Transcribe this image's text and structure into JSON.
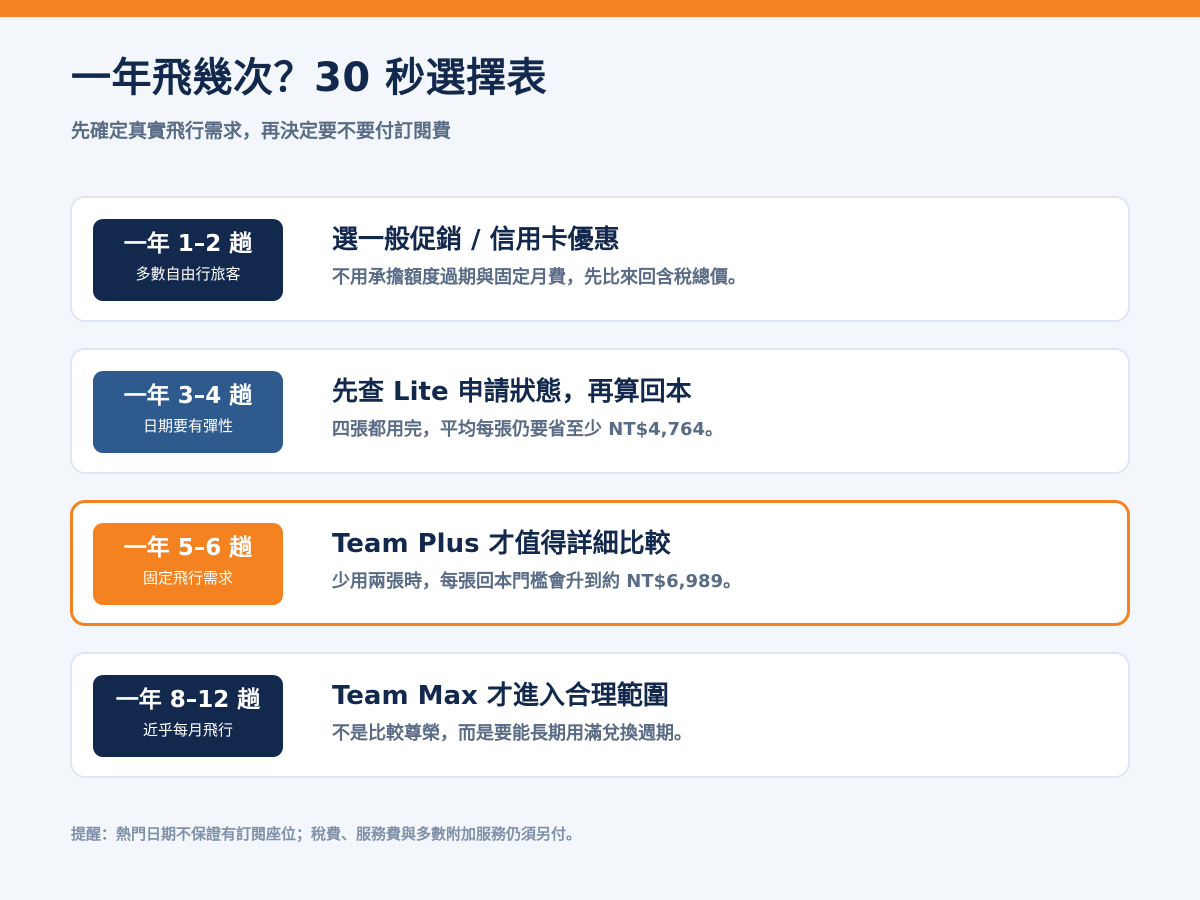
{
  "header": {
    "title": "一年飛幾次？30 秒選擇表",
    "subtitle": "先確定真實飛行需求，再決定要不要付訂閱費"
  },
  "colors": {
    "accent": "#f58220",
    "navy": "#13284d",
    "steel_blue": "#2f5a8e",
    "muted_text": "#5a6b86"
  },
  "cards": [
    {
      "badge_title": "一年 1–2 趟",
      "badge_sub": "多數自由行旅客",
      "heading": "選一般促銷 / 信用卡優惠",
      "desc": "不用承擔額度過期與固定月費，先比來回含稅總價。",
      "badge_color": "#13284d",
      "highlighted": false
    },
    {
      "badge_title": "一年 3–4 趟",
      "badge_sub": "日期要有彈性",
      "heading": "先查 Lite 申請狀態，再算回本",
      "desc": "四張都用完，平均每張仍要省至少 NT$4,764。",
      "badge_color": "#2f5a8e",
      "highlighted": false
    },
    {
      "badge_title": "一年 5–6 趟",
      "badge_sub": "固定飛行需求",
      "heading": "Team Plus 才值得詳細比較",
      "desc": "少用兩張時，每張回本門檻會升到約 NT$6,989。",
      "badge_color": "#f58220",
      "highlighted": true
    },
    {
      "badge_title": "一年 8–12 趟",
      "badge_sub": "近乎每月飛行",
      "heading": "Team Max 才進入合理範圍",
      "desc": "不是比較尊榮，而是要能長期用滿兌換週期。",
      "badge_color": "#13284d",
      "highlighted": false
    }
  ],
  "footnote": "提醒：熱門日期不保證有訂閱座位；稅費、服務費與多數附加服務仍須另付。"
}
